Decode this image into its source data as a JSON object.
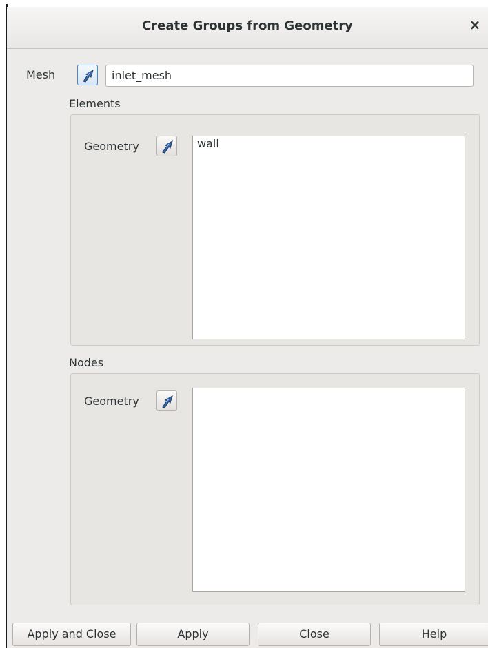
{
  "dialog": {
    "title": "Create Groups from Geometry",
    "close_glyph": "×"
  },
  "mesh": {
    "label": "Mesh",
    "value": "inlet_mesh",
    "select_icon": "selection-arrow-icon"
  },
  "elements": {
    "label": "Elements",
    "geometry_label": "Geometry",
    "items": [
      "wall"
    ]
  },
  "nodes": {
    "label": "Nodes",
    "geometry_label": "Geometry",
    "items": []
  },
  "buttons": {
    "apply_close": "Apply and Close",
    "apply": "Apply",
    "close": "Close",
    "help": "Help"
  },
  "colors": {
    "dialog_bg": "#edebe9",
    "active_accent": "#4a86c9",
    "icon_blue": "#3465a4"
  }
}
